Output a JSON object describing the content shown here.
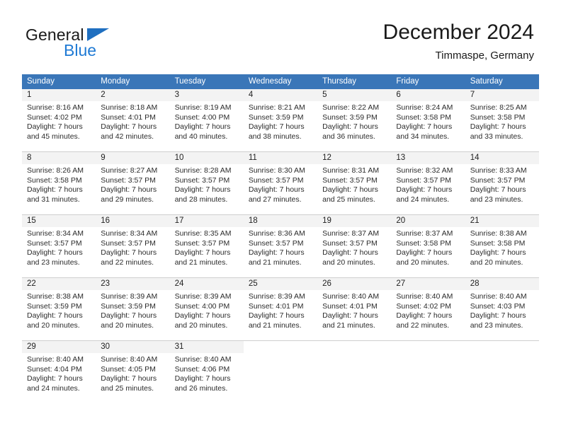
{
  "brand": {
    "name_dark": "General",
    "name_blue": "Blue",
    "flag_color": "#1f6fc0",
    "blue_color": "#1f7ad4"
  },
  "header": {
    "title": "December 2024",
    "location": "Timmaspe, Germany"
  },
  "theme": {
    "header_row_bg": "#3a76b8",
    "daynum_band_bg": "#f3f3f3",
    "row_divider": "#cfcfcf",
    "text": "#2b2b2b"
  },
  "weekdays": [
    "Sunday",
    "Monday",
    "Tuesday",
    "Wednesday",
    "Thursday",
    "Friday",
    "Saturday"
  ],
  "weeks": [
    [
      {
        "day": "1",
        "sunrise": "Sunrise: 8:16 AM",
        "sunset": "Sunset: 4:02 PM",
        "daylight1": "Daylight: 7 hours",
        "daylight2": "and 45 minutes."
      },
      {
        "day": "2",
        "sunrise": "Sunrise: 8:18 AM",
        "sunset": "Sunset: 4:01 PM",
        "daylight1": "Daylight: 7 hours",
        "daylight2": "and 42 minutes."
      },
      {
        "day": "3",
        "sunrise": "Sunrise: 8:19 AM",
        "sunset": "Sunset: 4:00 PM",
        "daylight1": "Daylight: 7 hours",
        "daylight2": "and 40 minutes."
      },
      {
        "day": "4",
        "sunrise": "Sunrise: 8:21 AM",
        "sunset": "Sunset: 3:59 PM",
        "daylight1": "Daylight: 7 hours",
        "daylight2": "and 38 minutes."
      },
      {
        "day": "5",
        "sunrise": "Sunrise: 8:22 AM",
        "sunset": "Sunset: 3:59 PM",
        "daylight1": "Daylight: 7 hours",
        "daylight2": "and 36 minutes."
      },
      {
        "day": "6",
        "sunrise": "Sunrise: 8:24 AM",
        "sunset": "Sunset: 3:58 PM",
        "daylight1": "Daylight: 7 hours",
        "daylight2": "and 34 minutes."
      },
      {
        "day": "7",
        "sunrise": "Sunrise: 8:25 AM",
        "sunset": "Sunset: 3:58 PM",
        "daylight1": "Daylight: 7 hours",
        "daylight2": "and 33 minutes."
      }
    ],
    [
      {
        "day": "8",
        "sunrise": "Sunrise: 8:26 AM",
        "sunset": "Sunset: 3:58 PM",
        "daylight1": "Daylight: 7 hours",
        "daylight2": "and 31 minutes."
      },
      {
        "day": "9",
        "sunrise": "Sunrise: 8:27 AM",
        "sunset": "Sunset: 3:57 PM",
        "daylight1": "Daylight: 7 hours",
        "daylight2": "and 29 minutes."
      },
      {
        "day": "10",
        "sunrise": "Sunrise: 8:28 AM",
        "sunset": "Sunset: 3:57 PM",
        "daylight1": "Daylight: 7 hours",
        "daylight2": "and 28 minutes."
      },
      {
        "day": "11",
        "sunrise": "Sunrise: 8:30 AM",
        "sunset": "Sunset: 3:57 PM",
        "daylight1": "Daylight: 7 hours",
        "daylight2": "and 27 minutes."
      },
      {
        "day": "12",
        "sunrise": "Sunrise: 8:31 AM",
        "sunset": "Sunset: 3:57 PM",
        "daylight1": "Daylight: 7 hours",
        "daylight2": "and 25 minutes."
      },
      {
        "day": "13",
        "sunrise": "Sunrise: 8:32 AM",
        "sunset": "Sunset: 3:57 PM",
        "daylight1": "Daylight: 7 hours",
        "daylight2": "and 24 minutes."
      },
      {
        "day": "14",
        "sunrise": "Sunrise: 8:33 AM",
        "sunset": "Sunset: 3:57 PM",
        "daylight1": "Daylight: 7 hours",
        "daylight2": "and 23 minutes."
      }
    ],
    [
      {
        "day": "15",
        "sunrise": "Sunrise: 8:34 AM",
        "sunset": "Sunset: 3:57 PM",
        "daylight1": "Daylight: 7 hours",
        "daylight2": "and 23 minutes."
      },
      {
        "day": "16",
        "sunrise": "Sunrise: 8:34 AM",
        "sunset": "Sunset: 3:57 PM",
        "daylight1": "Daylight: 7 hours",
        "daylight2": "and 22 minutes."
      },
      {
        "day": "17",
        "sunrise": "Sunrise: 8:35 AM",
        "sunset": "Sunset: 3:57 PM",
        "daylight1": "Daylight: 7 hours",
        "daylight2": "and 21 minutes."
      },
      {
        "day": "18",
        "sunrise": "Sunrise: 8:36 AM",
        "sunset": "Sunset: 3:57 PM",
        "daylight1": "Daylight: 7 hours",
        "daylight2": "and 21 minutes."
      },
      {
        "day": "19",
        "sunrise": "Sunrise: 8:37 AM",
        "sunset": "Sunset: 3:57 PM",
        "daylight1": "Daylight: 7 hours",
        "daylight2": "and 20 minutes."
      },
      {
        "day": "20",
        "sunrise": "Sunrise: 8:37 AM",
        "sunset": "Sunset: 3:58 PM",
        "daylight1": "Daylight: 7 hours",
        "daylight2": "and 20 minutes."
      },
      {
        "day": "21",
        "sunrise": "Sunrise: 8:38 AM",
        "sunset": "Sunset: 3:58 PM",
        "daylight1": "Daylight: 7 hours",
        "daylight2": "and 20 minutes."
      }
    ],
    [
      {
        "day": "22",
        "sunrise": "Sunrise: 8:38 AM",
        "sunset": "Sunset: 3:59 PM",
        "daylight1": "Daylight: 7 hours",
        "daylight2": "and 20 minutes."
      },
      {
        "day": "23",
        "sunrise": "Sunrise: 8:39 AM",
        "sunset": "Sunset: 3:59 PM",
        "daylight1": "Daylight: 7 hours",
        "daylight2": "and 20 minutes."
      },
      {
        "day": "24",
        "sunrise": "Sunrise: 8:39 AM",
        "sunset": "Sunset: 4:00 PM",
        "daylight1": "Daylight: 7 hours",
        "daylight2": "and 20 minutes."
      },
      {
        "day": "25",
        "sunrise": "Sunrise: 8:39 AM",
        "sunset": "Sunset: 4:01 PM",
        "daylight1": "Daylight: 7 hours",
        "daylight2": "and 21 minutes."
      },
      {
        "day": "26",
        "sunrise": "Sunrise: 8:40 AM",
        "sunset": "Sunset: 4:01 PM",
        "daylight1": "Daylight: 7 hours",
        "daylight2": "and 21 minutes."
      },
      {
        "day": "27",
        "sunrise": "Sunrise: 8:40 AM",
        "sunset": "Sunset: 4:02 PM",
        "daylight1": "Daylight: 7 hours",
        "daylight2": "and 22 minutes."
      },
      {
        "day": "28",
        "sunrise": "Sunrise: 8:40 AM",
        "sunset": "Sunset: 4:03 PM",
        "daylight1": "Daylight: 7 hours",
        "daylight2": "and 23 minutes."
      }
    ],
    [
      {
        "day": "29",
        "sunrise": "Sunrise: 8:40 AM",
        "sunset": "Sunset: 4:04 PM",
        "daylight1": "Daylight: 7 hours",
        "daylight2": "and 24 minutes."
      },
      {
        "day": "30",
        "sunrise": "Sunrise: 8:40 AM",
        "sunset": "Sunset: 4:05 PM",
        "daylight1": "Daylight: 7 hours",
        "daylight2": "and 25 minutes."
      },
      {
        "day": "31",
        "sunrise": "Sunrise: 8:40 AM",
        "sunset": "Sunset: 4:06 PM",
        "daylight1": "Daylight: 7 hours",
        "daylight2": "and 26 minutes."
      },
      {
        "day": "",
        "sunrise": "",
        "sunset": "",
        "daylight1": "",
        "daylight2": ""
      },
      {
        "day": "",
        "sunrise": "",
        "sunset": "",
        "daylight1": "",
        "daylight2": ""
      },
      {
        "day": "",
        "sunrise": "",
        "sunset": "",
        "daylight1": "",
        "daylight2": ""
      },
      {
        "day": "",
        "sunrise": "",
        "sunset": "",
        "daylight1": "",
        "daylight2": ""
      }
    ]
  ]
}
